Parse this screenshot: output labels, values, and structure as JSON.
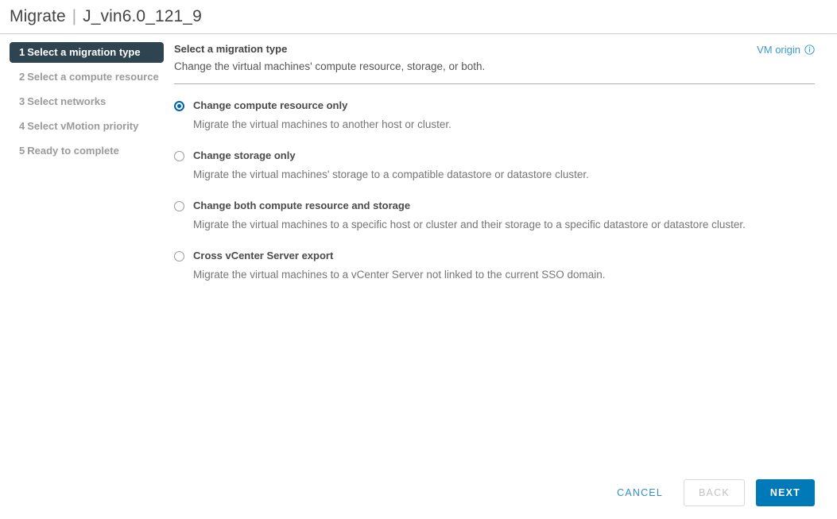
{
  "header": {
    "app_title": "Migrate",
    "separator": "|",
    "vm_name": "J_vin6.0_121_9"
  },
  "sidebar": {
    "steps": [
      {
        "num": "1",
        "label": "Select a migration type",
        "active": true
      },
      {
        "num": "2",
        "label": "Select a compute resource",
        "active": false
      },
      {
        "num": "3",
        "label": "Select networks",
        "active": false
      },
      {
        "num": "4",
        "label": "Select vMotion priority",
        "active": false
      },
      {
        "num": "5",
        "label": "Ready to complete",
        "active": false
      }
    ]
  },
  "content": {
    "title": "Select a migration type",
    "subtitle": "Change the virtual machines' compute resource, storage, or both.",
    "vm_origin_label": "VM origin",
    "vm_origin_icon": "info-circle-icon",
    "options": [
      {
        "label": "Change compute resource only",
        "description": "Migrate the virtual machines to another host or cluster.",
        "selected": true
      },
      {
        "label": "Change storage only",
        "description": "Migrate the virtual machines' storage to a compatible datastore or datastore cluster.",
        "selected": false
      },
      {
        "label": "Change both compute resource and storage",
        "description": "Migrate the virtual machines to a specific host or cluster and their storage to a specific datastore or datastore cluster.",
        "selected": false
      },
      {
        "label": "Cross vCenter Server export",
        "description": "Migrate the virtual machines to a vCenter Server not linked to the current SSO domain.",
        "selected": false
      }
    ]
  },
  "footer": {
    "cancel_label": "CANCEL",
    "back_label": "BACK",
    "back_disabled": true,
    "next_label": "NEXT"
  },
  "colors": {
    "accent_blue": "#0079b8",
    "link_blue": "#2f90c8",
    "active_step_bg": "#2e4451",
    "radio_selected": "#0065ab"
  }
}
